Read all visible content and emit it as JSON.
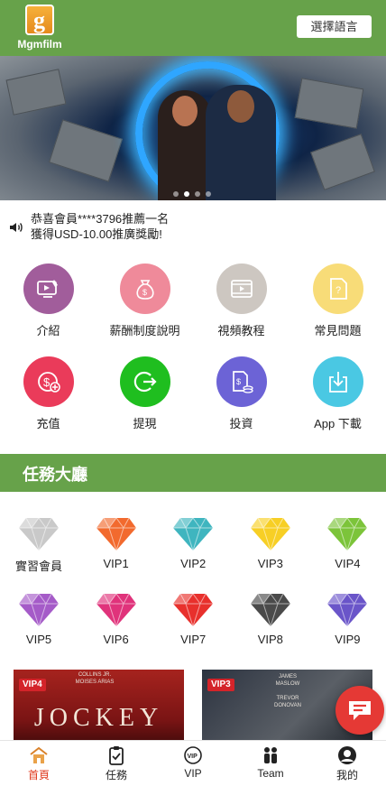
{
  "header": {
    "logo_glyph": "g",
    "logo_text": "Mgmfilm",
    "language_button": "選擇語言",
    "bg_color": "#67a24a"
  },
  "notice": {
    "line1": "恭喜會員****3796推薦一名",
    "line2": "獲得USD-10.00推廣獎勵!",
    "icon": "speaker-icon"
  },
  "menu": [
    {
      "label": "介紹",
      "icon": "video-intro-icon",
      "color": "#a15d9b"
    },
    {
      "label": "薪酬制度說明",
      "icon": "money-bag-icon",
      "color": "#ef8a9a"
    },
    {
      "label": "視頻教程",
      "icon": "film-icon",
      "color": "#cdc7c1"
    },
    {
      "label": "常見問題",
      "icon": "question-doc-icon",
      "color": "#f8dc78"
    },
    {
      "label": "充值",
      "icon": "recharge-icon",
      "color": "#ea3b5a"
    },
    {
      "label": "提現",
      "icon": "withdraw-icon",
      "color": "#1fbe1f"
    },
    {
      "label": "投資",
      "icon": "invest-doc-icon",
      "color": "#6c63d6"
    },
    {
      "label": "App 下載",
      "icon": "download-icon",
      "color": "#4ac8e3"
    }
  ],
  "task_hall": {
    "title": "任務大廳",
    "levels": [
      {
        "label": "實習會員",
        "color": "#c9c9c9"
      },
      {
        "label": "VIP1",
        "color": "#f26a2e"
      },
      {
        "label": "VIP2",
        "color": "#3fb5bf"
      },
      {
        "label": "VIP3",
        "color": "#f7cf25"
      },
      {
        "label": "VIP4",
        "color": "#7cc43a"
      },
      {
        "label": "VIP5",
        "color": "#a55bc8"
      },
      {
        "label": "VIP6",
        "color": "#e0337b"
      },
      {
        "label": "VIP7",
        "color": "#e8302c"
      },
      {
        "label": "VIP8",
        "color": "#4a4a4a"
      },
      {
        "label": "VIP9",
        "color": "#6a55c9"
      }
    ]
  },
  "movies": [
    {
      "tag": "VIP4",
      "title": "JOCKEY",
      "credits": "COLLINS JR.\nMOISES ARIAS"
    },
    {
      "tag": "VIP3",
      "title": "",
      "credits": "JAMES\nMASLOW\n\nTREVOR\nDONOVAN"
    }
  ],
  "chat_icon": "chat-bubble-icon",
  "bottom_nav": [
    {
      "label": "首頁",
      "icon": "home-icon",
      "active": true
    },
    {
      "label": "任務",
      "icon": "task-clipboard-icon",
      "active": false
    },
    {
      "label": "VIP",
      "icon": "vip-badge-icon",
      "active": false
    },
    {
      "label": "Team",
      "icon": "team-icon",
      "active": false
    },
    {
      "label": "我的",
      "icon": "profile-icon",
      "active": false
    }
  ],
  "active_color": "#e0391d"
}
